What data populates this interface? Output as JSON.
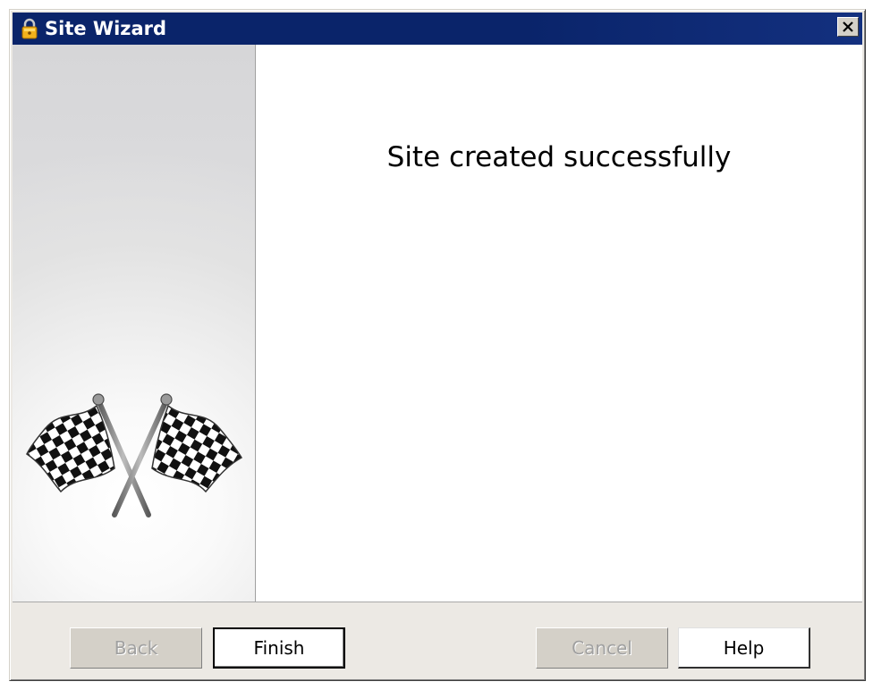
{
  "window": {
    "title": "Site Wizard",
    "title_icon": "lock-icon",
    "close_icon": "close-icon"
  },
  "side_panel": {
    "image": "checkered-flags-icon"
  },
  "main": {
    "heading": "Site created successfully"
  },
  "buttons": {
    "back": {
      "label": "Back",
      "enabled": false
    },
    "finish": {
      "label": "Finish",
      "enabled": true
    },
    "cancel": {
      "label": "Cancel",
      "enabled": false
    },
    "help": {
      "label": "Help",
      "enabled": true
    }
  },
  "colors": {
    "titlebar": "#0a246a",
    "dialog_face": "#ece9e4",
    "content_bg": "#ffffff"
  }
}
